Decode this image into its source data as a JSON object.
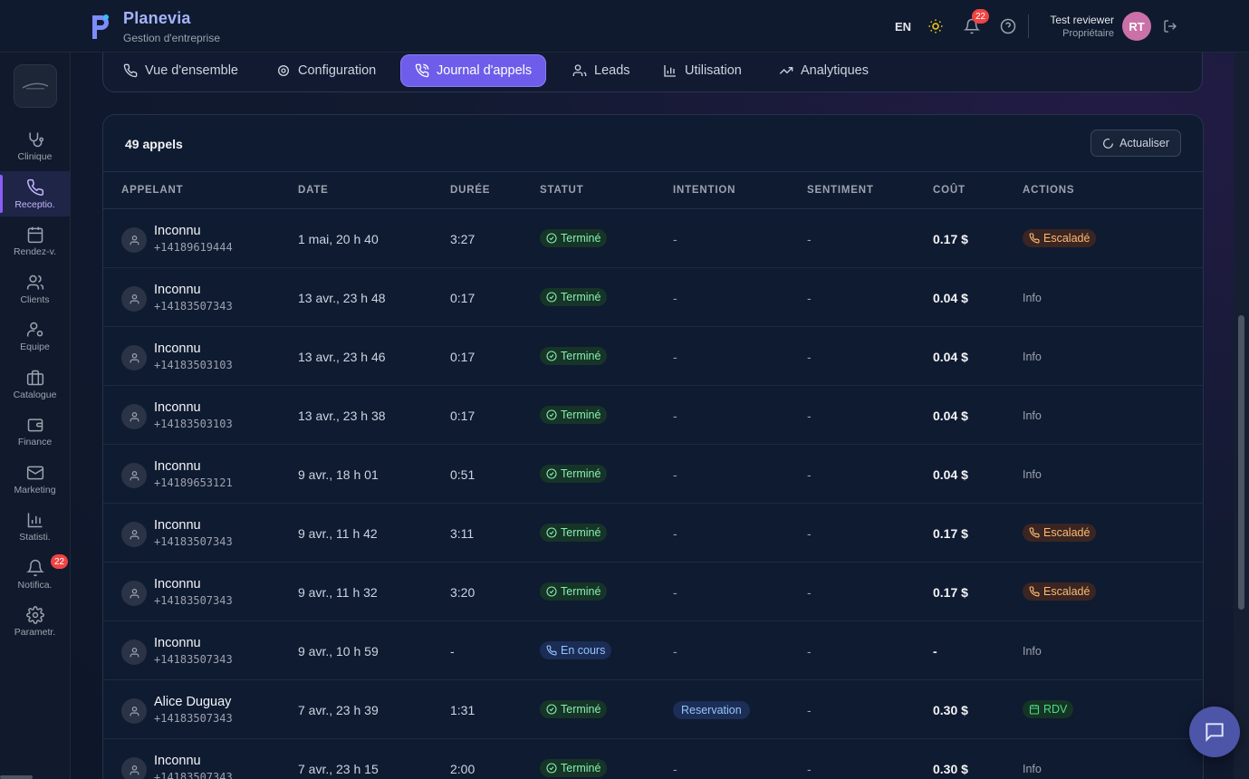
{
  "brand": {
    "name": "Planevia",
    "subtitle": "Gestion d'entreprise"
  },
  "header": {
    "language": "EN",
    "notifications_count": "22",
    "user_name": "Test reviewer",
    "user_role": "Propriétaire",
    "user_initials": "RT"
  },
  "sidebar": {
    "items": [
      {
        "label": "Clinique",
        "icon": "stethoscope-icon"
      },
      {
        "label": "Receptio.",
        "icon": "phone-icon",
        "active": true
      },
      {
        "label": "Rendez-v.",
        "icon": "calendar-icon"
      },
      {
        "label": "Clients",
        "icon": "users-icon"
      },
      {
        "label": "Equipe",
        "icon": "user-cog-icon"
      },
      {
        "label": "Catalogue",
        "icon": "briefcase-icon"
      },
      {
        "label": "Finance",
        "icon": "wallet-icon"
      },
      {
        "label": "Marketing",
        "icon": "mail-icon"
      },
      {
        "label": "Statisti.",
        "icon": "bar-chart-icon"
      },
      {
        "label": "Notifica.",
        "icon": "bell-icon",
        "badge": "22"
      },
      {
        "label": "Parametr.",
        "icon": "gear-icon"
      }
    ]
  },
  "tabs": [
    {
      "label": "Vue d'ensemble",
      "icon": "phone-icon"
    },
    {
      "label": "Configuration",
      "icon": "gear-icon"
    },
    {
      "label": "Journal d'appels",
      "icon": "phone-call-icon",
      "active": true
    },
    {
      "label": "Leads",
      "icon": "users-icon"
    },
    {
      "label": "Utilisation",
      "icon": "bar-chart-icon"
    },
    {
      "label": "Analytiques",
      "icon": "trending-up-icon"
    }
  ],
  "calls": {
    "count_label": "49 appels",
    "refresh_label": "Actualiser",
    "columns": [
      "APPELANT",
      "DATE",
      "DURÉE",
      "STATUT",
      "INTENTION",
      "SENTIMENT",
      "COÛT",
      "ACTIONS"
    ],
    "rows": [
      {
        "name": "Inconnu",
        "phone": "+14189619444",
        "date": "1 mai, 20 h 40",
        "duration": "3:27",
        "status": "Terminé",
        "status_type": "done",
        "intention": "-",
        "sentiment": "-",
        "cost": "0.17 $",
        "action": "Escaladé",
        "action_type": "escalated"
      },
      {
        "name": "Inconnu",
        "phone": "+14183507343",
        "date": "13 avr., 23 h 48",
        "duration": "0:17",
        "status": "Terminé",
        "status_type": "done",
        "intention": "-",
        "sentiment": "-",
        "cost": "0.04 $",
        "action": "Info",
        "action_type": "info"
      },
      {
        "name": "Inconnu",
        "phone": "+14183503103",
        "date": "13 avr., 23 h 46",
        "duration": "0:17",
        "status": "Terminé",
        "status_type": "done",
        "intention": "-",
        "sentiment": "-",
        "cost": "0.04 $",
        "action": "Info",
        "action_type": "info"
      },
      {
        "name": "Inconnu",
        "phone": "+14183503103",
        "date": "13 avr., 23 h 38",
        "duration": "0:17",
        "status": "Terminé",
        "status_type": "done",
        "intention": "-",
        "sentiment": "-",
        "cost": "0.04 $",
        "action": "Info",
        "action_type": "info"
      },
      {
        "name": "Inconnu",
        "phone": "+14189653121",
        "date": "9 avr., 18 h 01",
        "duration": "0:51",
        "status": "Terminé",
        "status_type": "done",
        "intention": "-",
        "sentiment": "-",
        "cost": "0.04 $",
        "action": "Info",
        "action_type": "info"
      },
      {
        "name": "Inconnu",
        "phone": "+14183507343",
        "date": "9 avr., 11 h 42",
        "duration": "3:11",
        "status": "Terminé",
        "status_type": "done",
        "intention": "-",
        "sentiment": "-",
        "cost": "0.17 $",
        "action": "Escaladé",
        "action_type": "escalated"
      },
      {
        "name": "Inconnu",
        "phone": "+14183507343",
        "date": "9 avr., 11 h 32",
        "duration": "3:20",
        "status": "Terminé",
        "status_type": "done",
        "intention": "-",
        "sentiment": "-",
        "cost": "0.17 $",
        "action": "Escaladé",
        "action_type": "escalated"
      },
      {
        "name": "Inconnu",
        "phone": "+14183507343",
        "date": "9 avr., 10 h 59",
        "duration": "-",
        "status": "En cours",
        "status_type": "live",
        "intention": "-",
        "sentiment": "-",
        "cost": "-",
        "action": "Info",
        "action_type": "info"
      },
      {
        "name": "Alice Duguay",
        "phone": "+14183507343",
        "date": "7 avr., 23 h 39",
        "duration": "1:31",
        "status": "Terminé",
        "status_type": "done",
        "intention": "Reservation",
        "sentiment": "-",
        "cost": "0.30 $",
        "action": "RDV",
        "action_type": "rdv"
      },
      {
        "name": "Inconnu",
        "phone": "+14183507343",
        "date": "7 avr., 23 h 15",
        "duration": "2:00",
        "status": "Terminé",
        "status_type": "done",
        "intention": "-",
        "sentiment": "-",
        "cost": "0.30 $",
        "action": "Info",
        "action_type": "info"
      }
    ]
  }
}
